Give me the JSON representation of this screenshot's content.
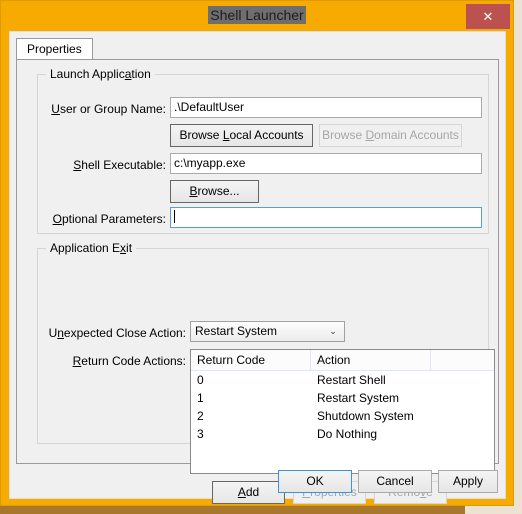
{
  "window": {
    "title": "Shell Launcher",
    "close_label": "✕",
    "accent_orange": "#f7ab00",
    "close_red": "#bc524f",
    "title_highlight": "#6e6e6e"
  },
  "tabs": [
    {
      "label": "Properties",
      "active": true
    }
  ],
  "launch_group": {
    "title_pre": "Launch Applic",
    "title_accel": "a",
    "title_post": "tion",
    "user_label_accel": "U",
    "user_label_rest": "ser or Group Name:",
    "user_value": ".\\DefaultUser",
    "browse_local_pre": "Browse ",
    "browse_local_accel": "L",
    "browse_local_post": "ocal Accounts",
    "browse_domain_pre": "Browse ",
    "browse_domain_accel": "D",
    "browse_domain_post": "omain Accounts",
    "browse_domain_disabled": true,
    "shell_label_accel": "S",
    "shell_label_rest": "hell Executable:",
    "shell_value": "c:\\myapp.exe",
    "browse_accel": "B",
    "browse_rest": "rowse...",
    "params_label_accel": "O",
    "params_label_rest": "ptional Parameters:",
    "params_value": "",
    "params_placeholder": ""
  },
  "exit_group": {
    "title_pre": "Application E",
    "title_accel": "x",
    "title_post": "it",
    "close_action_label_pre": "U",
    "close_action_label_accel": "n",
    "close_action_label_post": "expected Close Action:",
    "close_action_value": "Restart System",
    "close_action_options": [
      "Restart Shell",
      "Restart System",
      "Shutdown System",
      "Do Nothing"
    ],
    "close_action_arrow": "⌄",
    "return_codes_label_accel": "R",
    "return_codes_label_rest": "eturn Code Actions:",
    "columns": [
      "Return Code",
      "Action",
      ""
    ],
    "rows": [
      {
        "code": "0",
        "action": "Restart Shell"
      },
      {
        "code": "1",
        "action": "Restart System"
      },
      {
        "code": "2",
        "action": "Shutdown System"
      },
      {
        "code": "3",
        "action": "Do Nothing"
      }
    ],
    "add_accel": "A",
    "add_rest": "dd",
    "properties_accel": "P",
    "properties_rest": "roperties",
    "properties_disabled": true,
    "remove_pre": "Remo",
    "remove_accel": "v",
    "remove_post": "e",
    "remove_disabled": true
  },
  "footer": {
    "ok": "OK",
    "cancel": "Cancel",
    "apply": "Apply",
    "default_button": "OK"
  }
}
